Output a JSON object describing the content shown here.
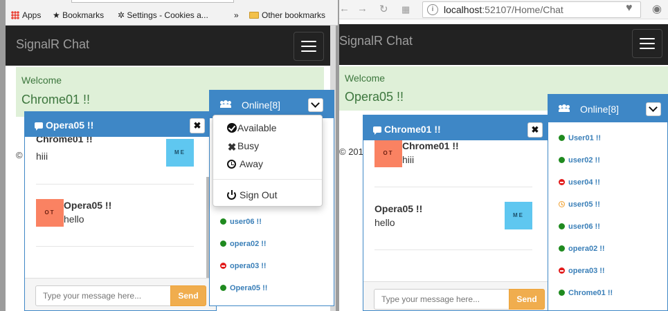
{
  "left_window": {
    "bookmarks": [
      {
        "label": "Apps",
        "icon": "apps-grid-icon"
      },
      {
        "label": "Bookmarks",
        "icon": "star-icon"
      },
      {
        "label": "Settings - Cookies a...",
        "icon": "gear-icon"
      },
      {
        "label": "»",
        "icon": ""
      },
      {
        "label": "Other bookmarks",
        "icon": "folder-icon"
      }
    ],
    "brand": "SignalR Chat",
    "welcome_label": "Welcome",
    "current_user": "Chrome01 !!",
    "footer_copyright": "©",
    "chat": {
      "title": "Opera05 !!",
      "messages": [
        {
          "name": "Chrome01 !!",
          "text": "hiii",
          "avatar": "ME",
          "mine": true
        },
        {
          "name": "Opera05 !!",
          "text": "hello",
          "avatar": "OT",
          "mine": false
        }
      ],
      "input_placeholder": "Type your message here...",
      "send_label": "Send"
    },
    "online": {
      "title": "Online[8]",
      "status_menu": [
        "Available",
        "Busy",
        "Away"
      ],
      "signout_label": "Sign Out",
      "users": [
        {
          "name": "user06 !!",
          "status": "available"
        },
        {
          "name": "opera02 !!",
          "status": "available"
        },
        {
          "name": "opera03 !!",
          "status": "busy"
        },
        {
          "name": "Opera05 !!",
          "status": "available"
        }
      ]
    }
  },
  "right_window": {
    "url_host": "localhost",
    "url_rest": ":52107/Home/Chat",
    "brand": "SignalR Chat",
    "welcome_label": "Welcome",
    "current_user": "Opera05 !!",
    "footer_copyright": "© 201",
    "chat": {
      "title": "Chrome01 !!",
      "messages": [
        {
          "name": "Chrome01 !!",
          "text": "hiii",
          "avatar": "OT",
          "mine": false
        },
        {
          "name": "Opera05 !!",
          "text": "hello",
          "avatar": "ME",
          "mine": true
        }
      ],
      "input_placeholder": "Type your message here...",
      "send_label": "Send"
    },
    "online": {
      "title": "Online[8]",
      "users": [
        {
          "name": "User01 !!",
          "status": "available"
        },
        {
          "name": "user02 !!",
          "status": "available"
        },
        {
          "name": "user04 !!",
          "status": "busy"
        },
        {
          "name": "user05 !!",
          "status": "away"
        },
        {
          "name": "user06 !!",
          "status": "available"
        },
        {
          "name": "opera02 !!",
          "status": "available"
        },
        {
          "name": "opera03 !!",
          "status": "busy"
        },
        {
          "name": "Chrome01 !!",
          "status": "available"
        }
      ]
    }
  },
  "colors": {
    "navbar": "#222222",
    "panel_blue": "#3e87c6",
    "welcome_bg": "#dff0d8",
    "send_button": "#f0ad4e",
    "avatar_me": "#5fc7f0",
    "avatar_other": "#fa8262",
    "status_available": "#1f8a1f",
    "status_busy": "#e21b1b",
    "status_away": "#f0a030"
  }
}
